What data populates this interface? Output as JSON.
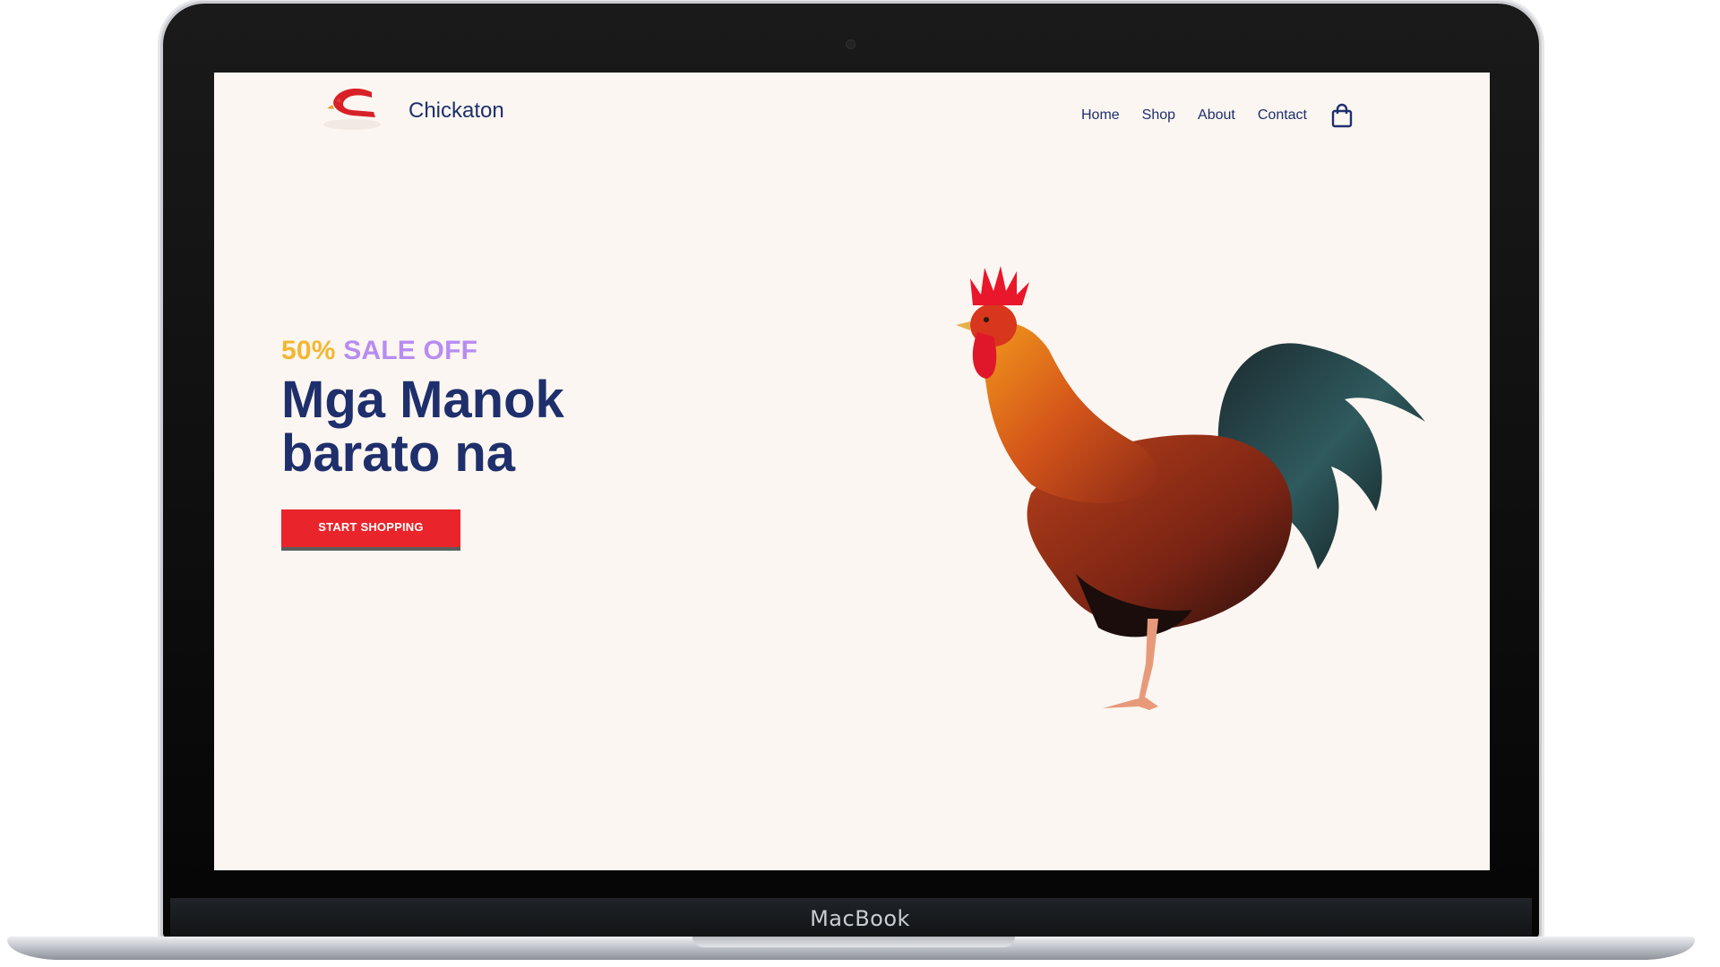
{
  "device": {
    "label": "MacBook"
  },
  "site": {
    "brand": "Chickaton",
    "nav": [
      {
        "label": "Home"
      },
      {
        "label": "Shop"
      },
      {
        "label": "About"
      },
      {
        "label": "Contact"
      }
    ],
    "cart_icon": "shopping-bag-icon",
    "logo_icon": "chicken-logo-icon"
  },
  "hero": {
    "sale_percent": "50%",
    "sale_text": "SALE OFF",
    "headline_line1": "Mga Manok",
    "headline_line2": "barato na",
    "cta_label": "START SHOPPING",
    "image": "rooster-image"
  },
  "colors": {
    "page_bg": "#fbf6f1",
    "primary_navy": "#1e2f6c",
    "accent_yellow": "#f2b731",
    "accent_purple": "#b78cf2",
    "cta_red": "#e9252b"
  }
}
